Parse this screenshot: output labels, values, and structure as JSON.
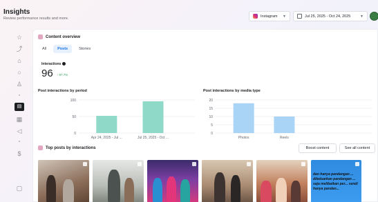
{
  "header": {
    "title": "Insights",
    "subtitle": "Review performance results and more.",
    "platform": "Instagram",
    "date_range": "Jul 25, 2025 - Oct 24, 2025"
  },
  "rail": {
    "icons": [
      "star-icon",
      "trend-icon",
      "home-icon",
      "chat-icon",
      "people-icon",
      "content-icon",
      "calendar-icon",
      "megaphone-icon",
      "money-icon",
      "help-icon"
    ]
  },
  "overview": {
    "title": "Content overview",
    "tabs": [
      "All",
      "Posts",
      "Stories"
    ],
    "selected_tab": "Posts",
    "interactions_label": "Interactions",
    "interactions_value": "96",
    "interactions_change": "↑ 97.7%"
  },
  "charts": {
    "by_period_title": "Post interactions by period",
    "by_media_title": "Post interactions by media type"
  },
  "chart_data": [
    {
      "type": "bar",
      "categories": [
        "Apr 24, 2025 - Jul ...",
        "Jul 25, 2025 - Oct ..."
      ],
      "values": [
        52,
        96
      ],
      "ylim": [
        0,
        100
      ],
      "yticks": [
        0,
        50,
        100
      ],
      "colors": [
        "#8fd9c8",
        "#8fd9c8"
      ]
    },
    {
      "type": "bar",
      "categories": [
        "Photos",
        "Reels"
      ],
      "values": [
        18,
        10
      ],
      "ylim": [
        0,
        20
      ],
      "yticks": [
        0,
        5,
        10,
        15,
        20
      ],
      "colors": [
        "#a9d4f5",
        "#a9d4f5"
      ]
    }
  ],
  "top_posts": {
    "title": "Top posts by interactions",
    "boost_label": "Boost content",
    "see_all_label": "See all content",
    "last_caption": "dan hanya pandangan ... dikeluarkan pandangan ... saja melibatkan per... sendi hanya pandan..."
  },
  "colors": {
    "accent": "#1b74e4",
    "positive": "#2e9d5b"
  }
}
